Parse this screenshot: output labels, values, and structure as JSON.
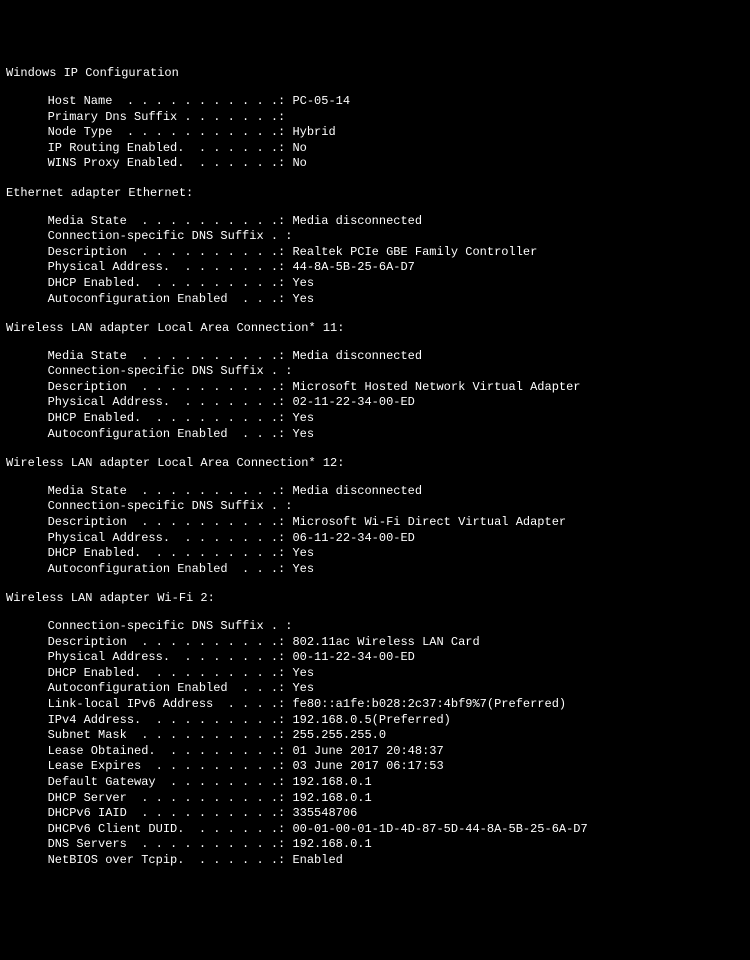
{
  "title": "Windows IP Configuration",
  "top": [
    {
      "label": "Host Name",
      "value": "PC-05-14"
    },
    {
      "label": "Primary Dns Suffix",
      "value": ""
    },
    {
      "label": "Node Type",
      "value": "Hybrid"
    },
    {
      "label": "IP Routing Enabled.",
      "value": "No"
    },
    {
      "label": "WINS Proxy Enabled.",
      "value": "No"
    }
  ],
  "adapters": [
    {
      "name": "Ethernet adapter Ethernet:",
      "rows": [
        {
          "label": "Media State",
          "value": "Media disconnected"
        },
        {
          "label": "Connection-specific DNS Suffix",
          "dots2": true,
          "value": ""
        },
        {
          "label": "Description",
          "value": "Realtek PCIe GBE Family Controller"
        },
        {
          "label": "Physical Address.",
          "value": "44-8A-5B-25-6A-D7"
        },
        {
          "label": "DHCP Enabled.",
          "value": "Yes"
        },
        {
          "label": "Autoconfiguration Enabled",
          "value": "Yes"
        }
      ]
    },
    {
      "name": "Wireless LAN adapter Local Area Connection* 11:",
      "rows": [
        {
          "label": "Media State",
          "value": "Media disconnected"
        },
        {
          "label": "Connection-specific DNS Suffix",
          "dots2": true,
          "value": ""
        },
        {
          "label": "Description",
          "value": "Microsoft Hosted Network Virtual Adapter"
        },
        {
          "label": "Physical Address.",
          "value": "02-11-22-34-00-ED"
        },
        {
          "label": "DHCP Enabled.",
          "value": "Yes"
        },
        {
          "label": "Autoconfiguration Enabled",
          "value": "Yes"
        }
      ]
    },
    {
      "name": "Wireless LAN adapter Local Area Connection* 12:",
      "rows": [
        {
          "label": "Media State",
          "value": "Media disconnected"
        },
        {
          "label": "Connection-specific DNS Suffix",
          "dots2": true,
          "value": ""
        },
        {
          "label": "Description",
          "value": "Microsoft Wi-Fi Direct Virtual Adapter"
        },
        {
          "label": "Physical Address.",
          "value": "06-11-22-34-00-ED"
        },
        {
          "label": "DHCP Enabled.",
          "value": "Yes"
        },
        {
          "label": "Autoconfiguration Enabled",
          "value": "Yes"
        }
      ]
    },
    {
      "name": "Wireless LAN adapter Wi-Fi 2:",
      "rows": [
        {
          "label": "Connection-specific DNS Suffix",
          "dots2": true,
          "value": ""
        },
        {
          "label": "Description",
          "value": "802.11ac Wireless LAN Card"
        },
        {
          "label": "Physical Address.",
          "value": "00-11-22-34-00-ED"
        },
        {
          "label": "DHCP Enabled.",
          "value": "Yes"
        },
        {
          "label": "Autoconfiguration Enabled",
          "value": "Yes"
        },
        {
          "label": "Link-local IPv6 Address",
          "value": "fe80::a1fe:b028:2c37:4bf9%7(Preferred)"
        },
        {
          "label": "IPv4 Address.",
          "value": "192.168.0.5(Preferred)"
        },
        {
          "label": "Subnet Mask",
          "value": "255.255.255.0"
        },
        {
          "label": "Lease Obtained.",
          "value": "01 June 2017 20:48:37"
        },
        {
          "label": "Lease Expires",
          "value": "03 June 2017 06:17:53"
        },
        {
          "label": "Default Gateway",
          "value": "192.168.0.1"
        },
        {
          "label": "DHCP Server",
          "value": "192.168.0.1"
        },
        {
          "label": "DHCPv6 IAID",
          "value": "335548706"
        },
        {
          "label": "DHCPv6 Client DUID.",
          "value": "00-01-00-01-1D-4D-87-5D-44-8A-5B-25-6A-D7"
        },
        {
          "label": "DNS Servers",
          "value": "192.168.0.1"
        },
        {
          "label": "NetBIOS over Tcpip.",
          "value": "Enabled"
        }
      ]
    }
  ]
}
